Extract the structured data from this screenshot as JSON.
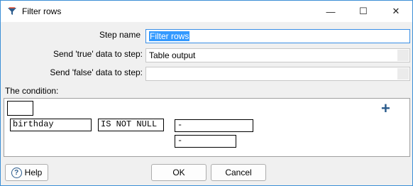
{
  "window": {
    "title": "Filter rows",
    "minimize_glyph": "—",
    "maximize_glyph": "☐",
    "close_glyph": "✕"
  },
  "form": {
    "step_name_label": "Step name",
    "step_name_value": "Filter rows",
    "send_true_label": "Send 'true' data to step:",
    "send_true_value": "Table output",
    "send_false_label": "Send 'false' data to step:",
    "send_false_value": ""
  },
  "condition": {
    "label": "The condition:",
    "negate_value": "",
    "field": "birthday",
    "function": "IS NOT NULL",
    "value": "-",
    "value2": "-",
    "add_glyph": "+"
  },
  "buttons": {
    "help": "Help",
    "help_glyph": "?",
    "ok": "OK",
    "cancel": "Cancel"
  },
  "colors": {
    "accent": "#3399ff",
    "icon_blue": "#2a5b8c"
  }
}
